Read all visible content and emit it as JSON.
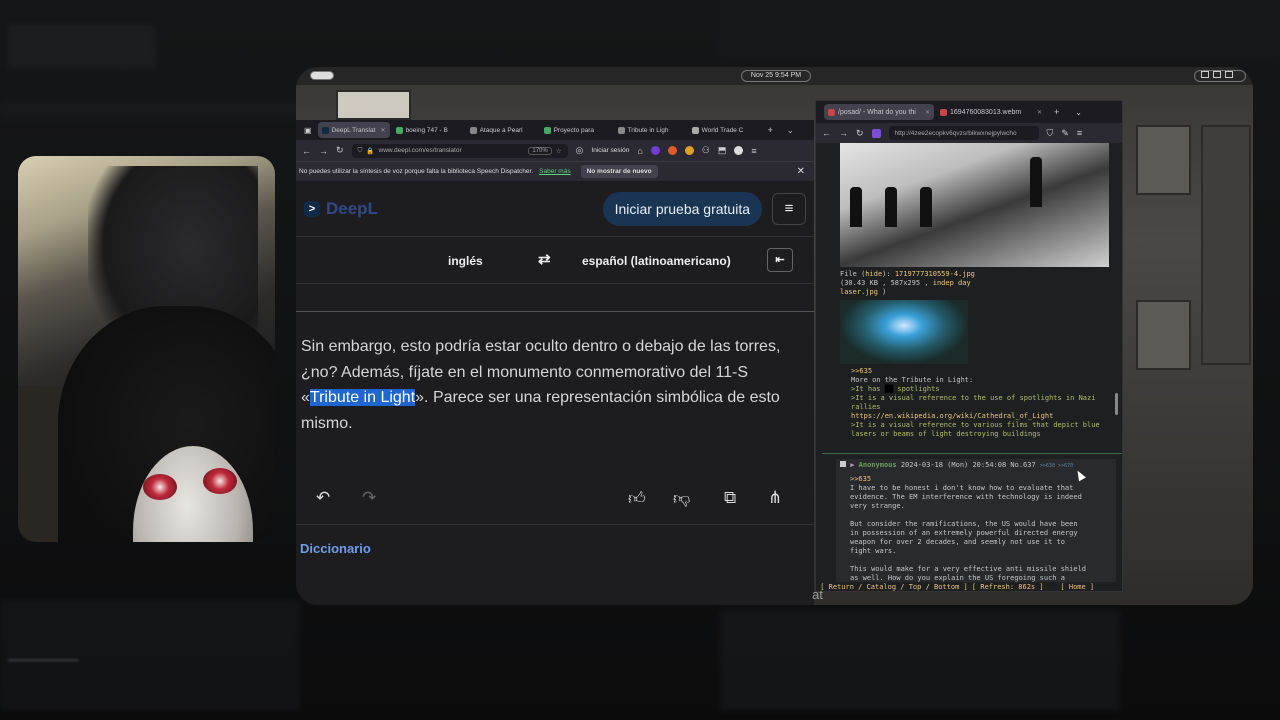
{
  "topbar": {
    "clock": "Nov 25   9:54 PM"
  },
  "deepl_browser": {
    "tabs": [
      {
        "label": "DeepL Translat",
        "active": true
      },
      {
        "label": "boeing 747 - B"
      },
      {
        "label": "Ataque a Pearl"
      },
      {
        "label": "Proyecto para"
      },
      {
        "label": "Tribute in Ligh"
      },
      {
        "label": "World Trade C"
      }
    ],
    "url": "www.deepl.com/es/translator",
    "zoom": "170%",
    "signin": "Iniciar sesión",
    "notification": {
      "text": "No puedes utilizar la síntesis de voz porque falta la biblioteca Speech Dispatcher.",
      "more_link": "Saber más",
      "dismiss": "No mostrar de nuevo"
    }
  },
  "deepl": {
    "logo": "DeepL",
    "trial_button": "Iniciar prueba gratuita",
    "source_lang": "inglés",
    "target_lang": "español (latinoamericano)",
    "translation_before": "Sin embargo, esto podría estar oculto dentro o debajo de las torres, ¿no? Además, fíjate en el monumento conmemorativo del 11-S «",
    "translation_highlight": "Tribute in Light",
    "translation_after": "». Parece ser una representación simbólica de esto mismo.",
    "dictionary_label": "Diccionario"
  },
  "chan_browser": {
    "tabs": [
      {
        "label": "/posad/ - What do you thi",
        "active": true
      },
      {
        "label": "1694760083013.webm"
      }
    ],
    "url": "http://4zee2ecopkv6qvzsrbikwxnejpylwcho"
  },
  "thread": {
    "file_label": "File",
    "file_hide": "hide",
    "file_name": "1719777310559-4.jpg",
    "file_meta": "30.43 KB , 587x295 ,",
    "file_alt": "indep day laser.jpg",
    "post1": {
      "reply_ref": ">>635",
      "line1": "More on the Tribute in Light:",
      "line2a": ">It has",
      "line2b": "spotlights",
      "line3": ">It is a visual reference to the use of spotlights in Nazi rallies",
      "link": "https://en.wikipedia.org/wiki/Cathedral_of_Light",
      "line4": ">It is a visual reference to various films that depict blue lasers or beams of light destroying buildings"
    },
    "post2": {
      "name": "Anonymous",
      "date": "2024-03-18 (Mon) 20:54:08",
      "no": "No.637",
      "backlinks": ">>638 >>670",
      "reply_ref": ">>635",
      "p1": "I have to be honest i don't know how to evaluate that evidence. The EM interference with technology is indeed very strange.",
      "p2": "But consider the ramifications, the US would have been in possession of an extremely powerful directed energy weapon for over 2 decades, and seemly not use it to fight wars.",
      "p3": "This would make for a very effective anti missile shield as well. How do you explain the US foregoing such a strategic advantage ?"
    },
    "footer": " [ Return / Catalog / Top / Bottom ] [ Refresh: 862s ]    [ Home ]"
  },
  "background": {
    "caption": "at"
  }
}
